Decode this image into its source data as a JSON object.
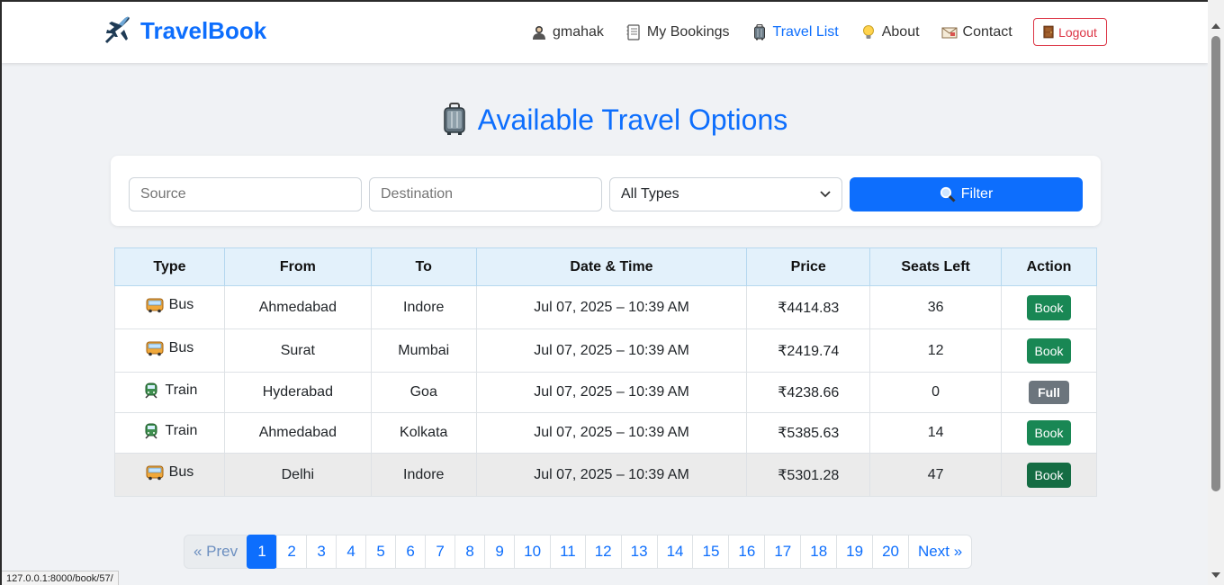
{
  "brand": {
    "name": "TravelBook"
  },
  "nav": {
    "items": [
      {
        "label": "gmahak",
        "icon": "user-icon"
      },
      {
        "label": "My Bookings",
        "icon": "notebook-icon"
      },
      {
        "label": "Travel List",
        "icon": "luggage-icon",
        "active": true
      },
      {
        "label": "About",
        "icon": "lightbulb-icon"
      },
      {
        "label": "Contact",
        "icon": "envelope-icon"
      }
    ],
    "logout": "Logout"
  },
  "page": {
    "title": "Available Travel Options"
  },
  "filter": {
    "source_placeholder": "Source",
    "destination_placeholder": "Destination",
    "type_selected": "All Types",
    "button": "Filter"
  },
  "table": {
    "headers": [
      "Type",
      "From",
      "To",
      "Date & Time",
      "Price",
      "Seats Left",
      "Action"
    ],
    "rows": [
      {
        "type": "Bus",
        "icon": "bus-icon",
        "from": "Ahmedabad",
        "to": "Indore",
        "datetime": "Jul 07, 2025 – 10:39 AM",
        "price": "₹4414.83",
        "seats": "36",
        "action": "Book"
      },
      {
        "type": "Bus",
        "icon": "bus-icon",
        "from": "Surat",
        "to": "Mumbai",
        "datetime": "Jul 07, 2025 – 10:39 AM",
        "price": "₹2419.74",
        "seats": "12",
        "action": "Book"
      },
      {
        "type": "Train",
        "icon": "train-icon",
        "from": "Hyderabad",
        "to": "Goa",
        "datetime": "Jul 07, 2025 – 10:39 AM",
        "price": "₹4238.66",
        "seats": "0",
        "action": "Full"
      },
      {
        "type": "Train",
        "icon": "train-icon",
        "from": "Ahmedabad",
        "to": "Kolkata",
        "datetime": "Jul 07, 2025 – 10:39 AM",
        "price": "₹5385.63",
        "seats": "14",
        "action": "Book"
      },
      {
        "type": "Bus",
        "icon": "bus-icon",
        "from": "Delhi",
        "to": "Indore",
        "datetime": "Jul 07, 2025 – 10:39 AM",
        "price": "₹5301.28",
        "seats": "47",
        "action": "Book"
      }
    ]
  },
  "pagination": {
    "prev": "« Prev",
    "pages": [
      "1",
      "2",
      "3",
      "4",
      "5",
      "6",
      "7",
      "8",
      "9",
      "10",
      "11",
      "12",
      "13",
      "14",
      "15",
      "16",
      "17",
      "18",
      "19",
      "20"
    ],
    "current": "1",
    "next": "Next »"
  },
  "status_bar": {
    "url": "127.0.0.1:8000/book/57/"
  },
  "colors": {
    "primary": "#0d6efd",
    "success": "#198754",
    "danger": "#dc3545",
    "secondary": "#6c757d"
  }
}
